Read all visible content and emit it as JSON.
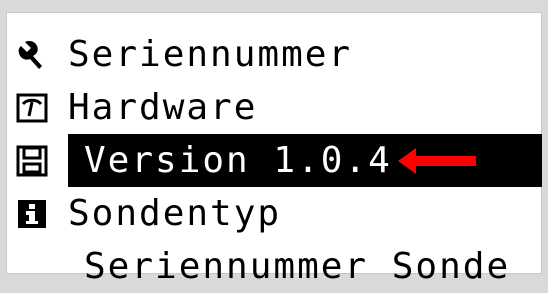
{
  "menu": {
    "items": [
      {
        "label": "Seriennummer",
        "icon": "wrench-icon"
      },
      {
        "label": "Hardware",
        "icon": "gauge-icon"
      },
      {
        "label": "Version 1.0.4",
        "icon": "save-icon",
        "selected": true
      },
      {
        "label": "Sondentyp",
        "icon": "info-icon"
      },
      {
        "label": "Seriennummer Sonde",
        "icon": ""
      }
    ]
  },
  "colors": {
    "selected_background": "#000000",
    "selected_text": "#ffffff",
    "pointer_arrow": "#ff0000"
  }
}
